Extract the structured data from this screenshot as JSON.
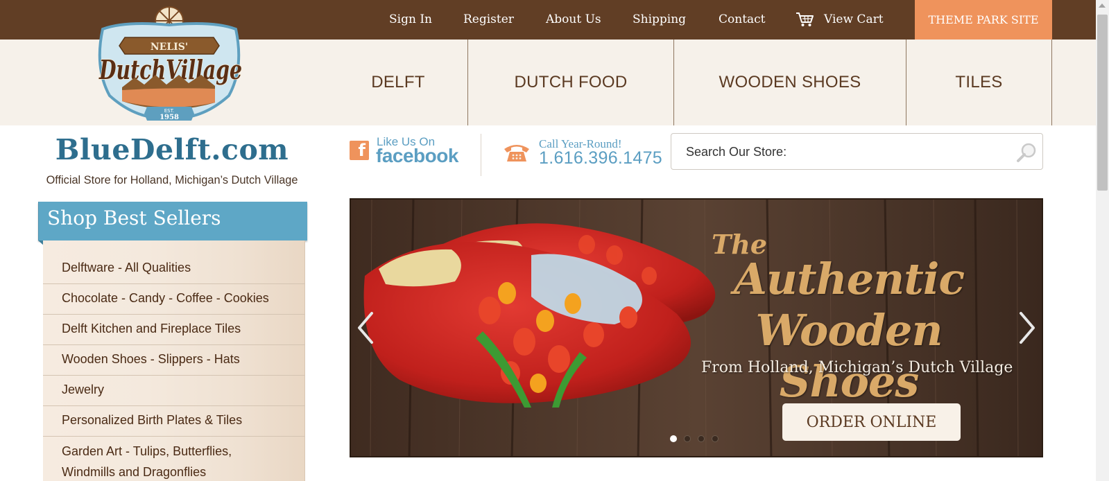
{
  "top_nav": {
    "links": [
      "Sign In",
      "Register",
      "About Us",
      "Shipping",
      "Contact",
      "View Cart"
    ],
    "cart_icon": "shopping-cart-icon",
    "theme_park_label": "THEME PARK SITE"
  },
  "logo": {
    "small_text": "NELIS'",
    "brand": "DutchVillage",
    "est": "EST.",
    "year": "1958"
  },
  "categories": [
    "DELFT",
    "DUTCH FOOD",
    "WOODEN SHOES",
    "TILES"
  ],
  "site": {
    "name": "BlueDelft.com",
    "tagline": "Official Store for Holland, Michigan’s Dutch Village"
  },
  "social": {
    "icon": "facebook-icon",
    "like_text": "Like Us On",
    "network": "facebook"
  },
  "contact": {
    "icon": "telephone-icon",
    "label": "Call Year-Round!",
    "phone": "1.616.396.1475"
  },
  "search": {
    "placeholder": "Search Our Store:",
    "icon": "search-icon"
  },
  "sidebar": {
    "title": "Shop Best Sellers",
    "items": [
      "Delftware - All Qualities",
      "Chocolate - Candy - Coffee - Cookies",
      "Delft Kitchen and Fireplace Tiles",
      "Wooden Shoes - Slippers - Hats",
      "Jewelry",
      "Personalized Birth Plates & Tiles",
      "Garden Art - Tulips, Butterflies,",
      "Windmills and Dragonflies"
    ]
  },
  "banner": {
    "title_small": "The",
    "title_line1": "Authentic",
    "title_line2": "Wooden Shoes",
    "subtitle": "From Holland, Michigan’s Dutch Village",
    "button": "ORDER ONLINE",
    "prev_icon": "chevron-left-icon",
    "next_icon": "chevron-right-icon",
    "slide_count": 4,
    "active_slide": 1
  },
  "colors": {
    "top_bar": "#613e25",
    "accent_orange": "#ef935c",
    "nav_bg": "#f6f1ea",
    "brand_blue": "#2e6e8e",
    "sidebar_header": "#5ea7c6",
    "link_blue": "#5b9ec2"
  }
}
